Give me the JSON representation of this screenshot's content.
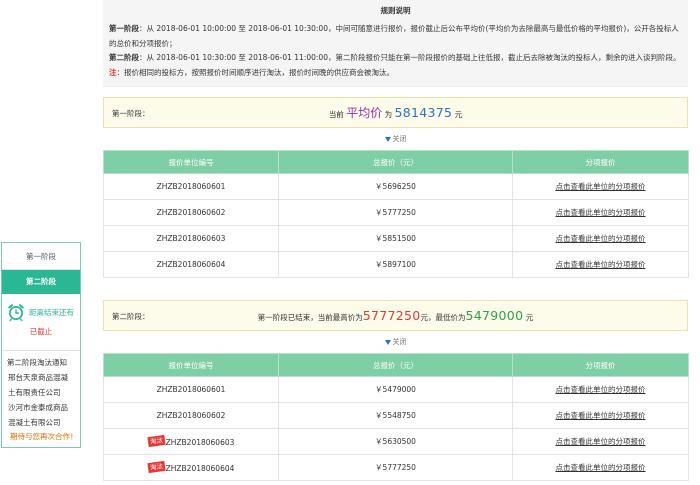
{
  "side": {
    "header": "第一阶段",
    "active_tab": "第二阶段",
    "countdown_label": "距离结束还有",
    "ended": "已截止",
    "notice_title": "第二阶段淘汰通知",
    "notice_items": [
      "邢台天泉商品混凝",
      "土有限责任公司",
      "沙河市金泰成商品",
      "混凝土有限公司"
    ],
    "notice_footer": "期待与您再次合作！"
  },
  "rules": {
    "title": "规则说明",
    "line1_label": "第一阶段",
    "line1_text": "：从 2018-06-01 10:00:00 至 2018-06-01 10:30:00，中间可随意进行报价，报价截止后公布平均价(平均价为去除最高与最低价格的平均报价)，公开各投标人的总价和分项报价；",
    "line2_label": "第二阶段",
    "line2_text": "：从 2018-06-01 10:30:00 至 2018-06-01 11:00:00，第二阶段报价只能在第一阶段报价的基础上往低报，截止后去除被淘汰的投标人，剩余的进入谈判阶段。",
    "note_label": "注",
    "note_text": "：报价相同的投标方，按照报价时间顺序进行淘汰，报价时间晚的供应商会被淘汰。"
  },
  "stage1": {
    "label": "第一阶段：",
    "prefix": "当前",
    "avg_word": "平均价",
    "mid": "为",
    "avg_value": "5814375",
    "unit": "元",
    "toggle": "关闭",
    "headers": [
      "报价单位编号",
      "总报价（元）",
      "分项报价"
    ],
    "rows": [
      {
        "id": "ZHZB2018060601",
        "price": "￥5696250",
        "link": "点击查看此单位的分项报价"
      },
      {
        "id": "ZHZB2018060602",
        "price": "￥5777250",
        "link": "点击查看此单位的分项报价"
      },
      {
        "id": "ZHZB2018060603",
        "price": "￥5851500",
        "link": "点击查看此单位的分项报价"
      },
      {
        "id": "ZHZB2018060604",
        "price": "￥5897100",
        "link": "点击查看此单位的分项报价"
      }
    ]
  },
  "stage2": {
    "label": "第二阶段：",
    "text1": "第一阶段已结束，当前最高价为",
    "max_value": "5777250",
    "text2": "元，最低价为",
    "min_value": "5479000",
    "unit": "元",
    "toggle": "关闭",
    "headers": [
      "报价单位编号",
      "总报价（元）",
      "分项报价"
    ],
    "tag": "淘汰",
    "rows": [
      {
        "id": "ZHZB2018060601",
        "price": "￥5479000",
        "link": "点击查看此单位的分项报价"
      },
      {
        "id": "ZHZB2018060602",
        "price": "￥5548750",
        "link": "点击查看此单位的分项报价"
      },
      {
        "id": "ZHZB2018060603",
        "price": "￥5630500",
        "link": "点击查看此单位的分项报价"
      },
      {
        "id": "ZHZB2018060604",
        "price": "￥5777250",
        "link": "点击查看此单位的分项报价"
      }
    ]
  },
  "colors": {
    "accent": "#2ab794",
    "table_header": "#7fcfa6",
    "avg_word": "#9b2fae",
    "avg_value": "#2a73c4",
    "max_value": "#e53935",
    "min_value": "#2ea04a"
  },
  "icons": {
    "clock": "alarm-clock-icon",
    "toggle": "caret-down-icon"
  }
}
